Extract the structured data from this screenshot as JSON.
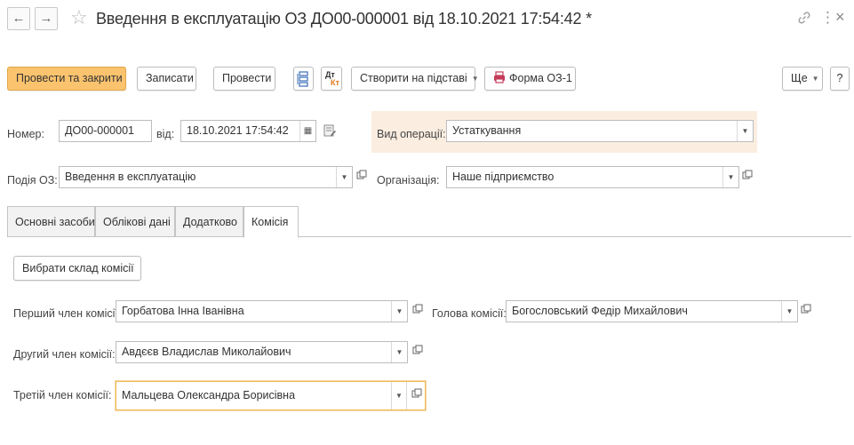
{
  "header": {
    "title": "Введення в експлуатацію ОЗ ДО00-000001 від 18.10.2021 17:54:42 *",
    "back_icon": "←",
    "forward_icon": "→",
    "star_icon": "☆",
    "menu_icon": "⋮",
    "close_icon": "×"
  },
  "toolbar": {
    "post_close": "Провести та закрити",
    "save": "Записати",
    "post": "Провести",
    "create_based": "Створити на підставі",
    "form": "Форма ОЗ-1",
    "more": "Ще",
    "help": "?",
    "dt_label": "Дт",
    "kt_label": "Кт"
  },
  "form": {
    "number_label": "Номер:",
    "number_value": "ДО00-000001",
    "date_label": "від:",
    "date_value": "18.10.2021 17:54:42",
    "operation_label": "Вид операції:",
    "operation_value": "Устаткування",
    "event_label": "Подія ОЗ:",
    "event_value": "Введення в експлуатацію",
    "org_label": "Організація:",
    "org_value": "Наше підприємство"
  },
  "tabs": [
    {
      "label": "Основні засоби",
      "active": false
    },
    {
      "label": "Облікові дані",
      "active": false
    },
    {
      "label": "Додатково",
      "active": false
    },
    {
      "label": "Комісія",
      "active": true
    }
  ],
  "commission": {
    "select_button": "Вибрати склад комісії",
    "first_label": "Перший член комісії:",
    "first_value": "Горбатова Інна Іванівна",
    "head_label": "Голова комісії:",
    "head_value": "Богословський Федір Михайлович",
    "second_label": "Другий член комісії:",
    "second_value": "Авдєєв Владислав Миколайович",
    "third_label": "Третій член комісії:",
    "third_value": "Мальцева Олександра Борисівна"
  },
  "colors": {
    "primary_button": "#fbc36e",
    "focus_border": "#f0b859",
    "highlight_bg": "#fbeee1",
    "printer_icon": "#c33d5a",
    "dt_kt_icon": "#e07a1f"
  }
}
